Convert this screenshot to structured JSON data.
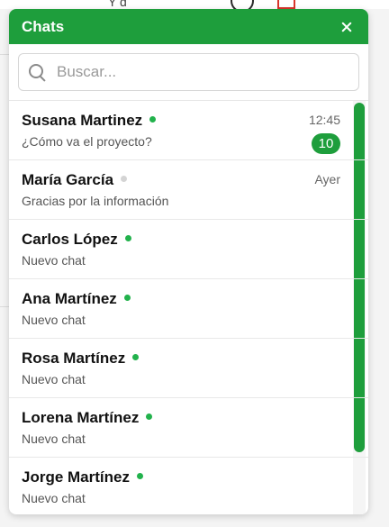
{
  "background": {
    "partial_text": "Y         d"
  },
  "header": {
    "title": "Chats",
    "close_icon": "close-icon"
  },
  "search": {
    "placeholder": "Buscar...",
    "icon": "search-icon"
  },
  "colors": {
    "accent": "#1e9e3c",
    "online": "#22b24c",
    "offline": "#d4d4d4"
  },
  "chats": [
    {
      "name": "Susana Martinez",
      "preview": "¿Cómo va el proyecto?",
      "time": "12:45",
      "unread": "10",
      "status": "online"
    },
    {
      "name": "María García",
      "preview": "Gracias por la información",
      "time": "Ayer",
      "unread": "",
      "status": "offline"
    },
    {
      "name": "Carlos López",
      "preview": "Nuevo chat",
      "time": "",
      "unread": "",
      "status": "online"
    },
    {
      "name": "Ana Martínez",
      "preview": "Nuevo chat",
      "time": "",
      "unread": "",
      "status": "online"
    },
    {
      "name": "Rosa Martínez",
      "preview": "Nuevo chat",
      "time": "",
      "unread": "",
      "status": "online"
    },
    {
      "name": "Lorena Martínez",
      "preview": "Nuevo chat",
      "time": "",
      "unread": "",
      "status": "online"
    },
    {
      "name": "Jorge Martínez",
      "preview": "Nuevo chat",
      "time": "",
      "unread": "",
      "status": "online"
    }
  ]
}
